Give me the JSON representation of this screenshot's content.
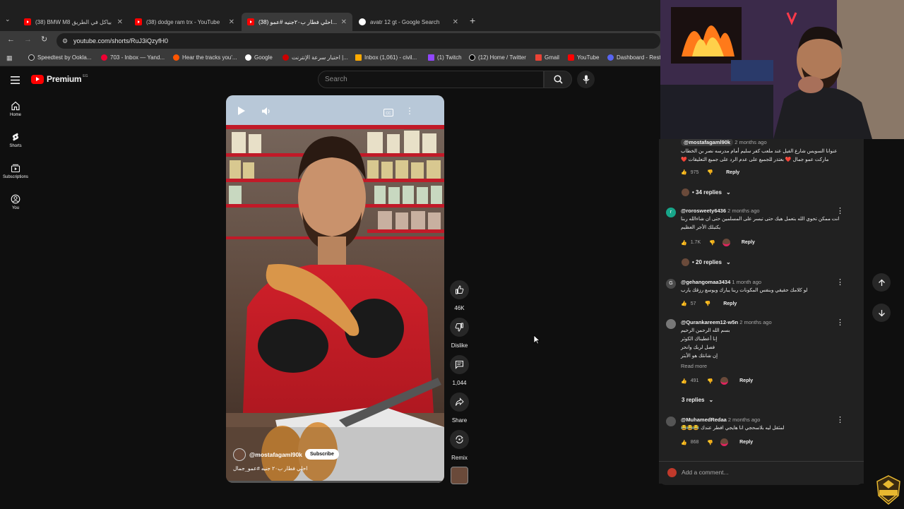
{
  "browser": {
    "tabs": [
      {
        "title": "(38) BMW M8 بياكل في الطريق",
        "active": false
      },
      {
        "title": "(38) dodge ram trx - YouTube",
        "active": false
      },
      {
        "title": "(38) احلي فطار ب٢٠جنيه #عمو...",
        "active": true
      },
      {
        "title": "avatr 12 gt - Google Search",
        "active": false
      }
    ],
    "url": "youtube.com/shorts/RuJ3iQzyfH0",
    "bookmarks": [
      "Speedtest by Ookla...",
      "703 - Inbox — Yand...",
      "Hear the tracks you'...",
      "Google",
      "اختبار سرعة الإنترنت |...",
      "Inbox (1,061) - civil...",
      "(1) Twitch",
      "(12) Home / Twitter",
      "Gmail",
      "YouTube",
      "Dashboard - Rest"
    ]
  },
  "youtube": {
    "logo_text": "Premium",
    "country": "EG",
    "search_placeholder": "Search",
    "nav": [
      {
        "label": "Home",
        "icon": "home-icon"
      },
      {
        "label": "Shorts",
        "icon": "shorts-icon"
      },
      {
        "label": "Subscriptions",
        "icon": "subscriptions-icon"
      },
      {
        "label": "You",
        "icon": "you-icon"
      }
    ]
  },
  "short": {
    "channel": "@mostafagaml90k",
    "subscribe_label": "Subscribe",
    "caption": "احلي فطار ب٢٠ جنيه #عمو_جمال",
    "likes": "46K",
    "dislike_label": "Dislike",
    "comments": "1,044",
    "share_label": "Share",
    "remix_label": "Remix"
  },
  "comments": {
    "items": [
      {
        "author": "@mostafagaml90k",
        "time": "2 months ago",
        "text": "عنوانا السويس شارع الفيل عند ملعب كفر سليم أمام مدرسه نصر بن الخطاب ماركت عمو جمال ❤️ بعتذر للجميع على عدم الرد على جميع التعليقات ❤️",
        "likes": "975",
        "reply_label": "Reply",
        "replies": "• 34 replies"
      },
      {
        "author": "@rorosweety6436",
        "time": "2 months ago",
        "text": "انت ممكن تحوي الله بتعمل هيك حتى تيسر على المسلمين حتى ان شاءالله ربنا يكتبلك الأجر العظيم",
        "likes": "1.7K",
        "reply_label": "Reply",
        "replies": "• 20 replies",
        "avatar_letter": "r"
      },
      {
        "author": "@gehangomaa3434",
        "time": "1 month ago",
        "text": "لو كلامك حقيقي وبنفس المكونات ربنا يبارك ويوسع رزقك يارب",
        "likes": "57",
        "reply_label": "Reply",
        "avatar_letter": "G"
      },
      {
        "author": "@Qurankareem12-w5n",
        "time": "2 months ago",
        "lines": [
          "بسم الله الرحمن الرحيم",
          "إنا أعطيناك الكوثر",
          "فصل لربك وانحر",
          "إن شانئك هو الأبتر"
        ],
        "read_more": "Read more",
        "likes": "491",
        "reply_label": "Reply",
        "replies": "3 replies"
      },
      {
        "author": "@MuhamedRedaa",
        "time": "2 months ago",
        "text": "لمثقل ليه بلاسحجي انا هايجي افطر عندك 😂😂😂",
        "likes": "868",
        "reply_label": "Reply"
      }
    ],
    "add_placeholder": "Add a comment..."
  },
  "colors": {
    "brand": "#ff0000",
    "background": "#0f0f0f",
    "panel": "#212121"
  }
}
